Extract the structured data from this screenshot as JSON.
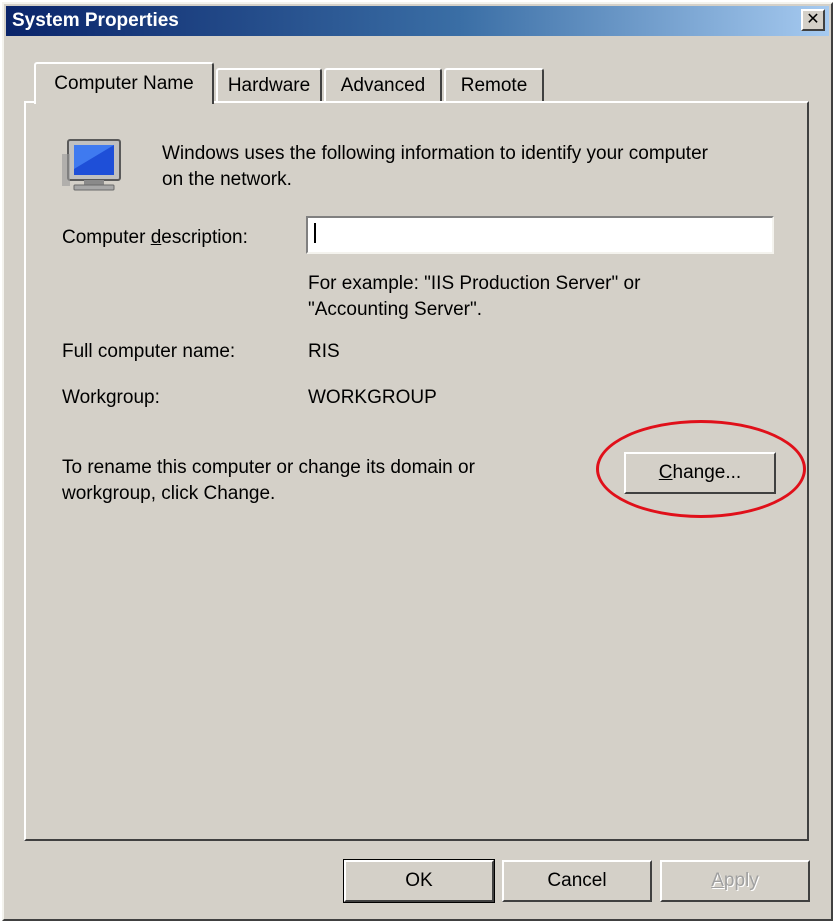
{
  "window": {
    "title": "System Properties",
    "close_glyph": "✕"
  },
  "tabs": [
    {
      "label": "Computer Name",
      "active": true
    },
    {
      "label": "Hardware",
      "active": false
    },
    {
      "label": "Advanced",
      "active": false
    },
    {
      "label": "Remote",
      "active": false
    }
  ],
  "panel": {
    "intro_line1": "Windows uses the following information to identify your computer",
    "intro_line2": "on the network.",
    "description_label_pre": "Computer ",
    "description_label_hotkey": "d",
    "description_label_post": "escription:",
    "description_value": "",
    "example_line1": "For example: \"IIS Production Server\" or",
    "example_line2": "\"Accounting Server\".",
    "full_name_label": "Full computer name:",
    "full_name_value": "RIS",
    "workgroup_label": "Workgroup:",
    "workgroup_value": "WORKGROUP",
    "rename_line1": "To rename this computer or change its domain or",
    "rename_line2": "workgroup, click Change.",
    "change_hotkey": "C",
    "change_rest": "hange..."
  },
  "footer": {
    "ok_label": "OK",
    "cancel_label": "Cancel",
    "apply_hotkey": "A",
    "apply_rest": "pply"
  },
  "colors": {
    "dialog_bg": "#d4d0c8",
    "titlebar_start": "#0a246a",
    "titlebar_end": "#a6caf0",
    "annotation_ring": "#e0101a"
  },
  "icons": [
    "computer-monitor-icon",
    "close-icon"
  ]
}
